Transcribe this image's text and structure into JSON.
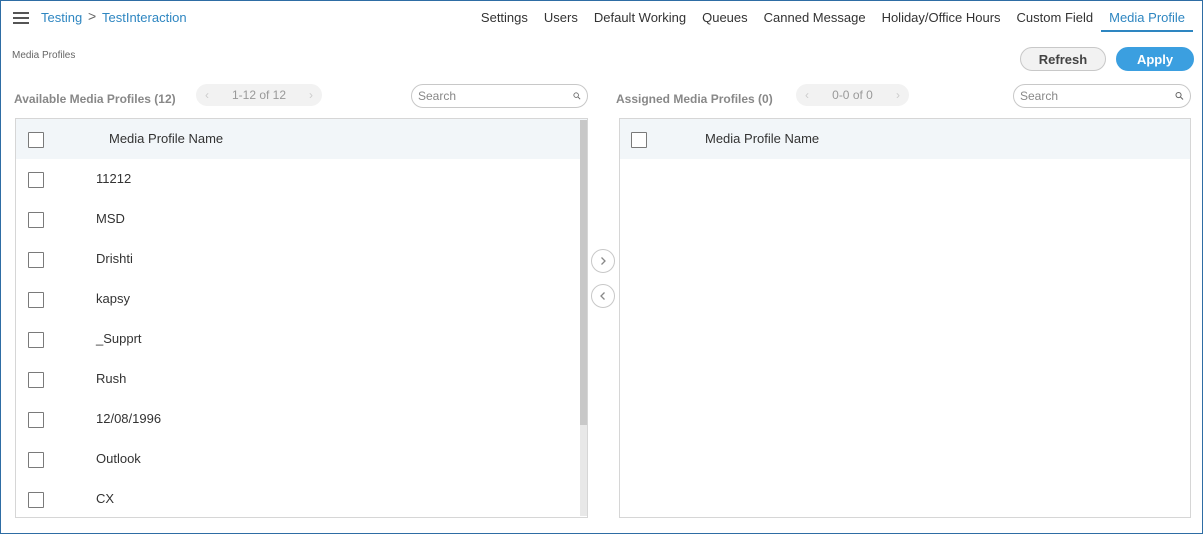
{
  "breadcrumb": {
    "root": "Testing",
    "separator": ">",
    "current": "TestInteraction"
  },
  "tabs": [
    {
      "label": "Settings"
    },
    {
      "label": "Users"
    },
    {
      "label": "Default Working"
    },
    {
      "label": "Queues"
    },
    {
      "label": "Canned Message"
    },
    {
      "label": "Holiday/Office Hours"
    },
    {
      "label": "Custom Field"
    },
    {
      "label": "Media Profile",
      "active": true
    }
  ],
  "page_title": "Media Profiles",
  "actions": {
    "refresh_label": "Refresh",
    "apply_label": "Apply"
  },
  "available": {
    "label": "Available Media Profiles (12)",
    "pager": "1-12 of 12",
    "search_placeholder": "Search",
    "column_header": "Media Profile Name",
    "rows": [
      {
        "name": "11212"
      },
      {
        "name": "MSD"
      },
      {
        "name": "Drishti"
      },
      {
        "name": "kapsy"
      },
      {
        "name": "_Supprt"
      },
      {
        "name": "Rush"
      },
      {
        "name": "12/08/1996"
      },
      {
        "name": "Outlook"
      },
      {
        "name": "CX"
      }
    ]
  },
  "assigned": {
    "label": "Assigned Media Profiles (0)",
    "pager": "0-0 of 0",
    "search_placeholder": "Search",
    "column_header": "Media Profile Name",
    "rows": []
  },
  "icons": {
    "menu": "hamburger-icon",
    "search": "search-icon",
    "move_right": "chevron-right-icon",
    "move_left": "chevron-left-icon"
  },
  "colors": {
    "accent": "#2e86c1",
    "apply": "#3b9fe0",
    "header_bg": "#f2f6f9"
  }
}
